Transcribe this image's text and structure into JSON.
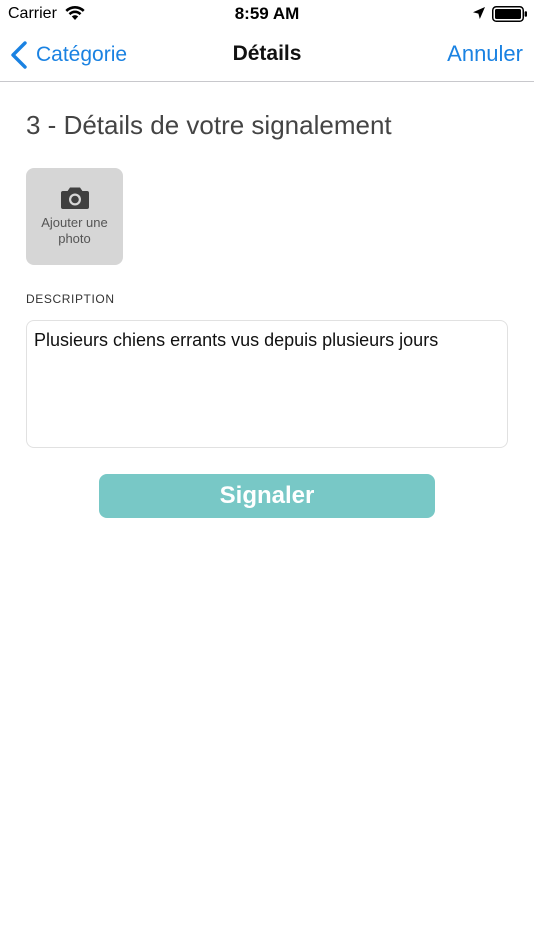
{
  "status_bar": {
    "carrier": "Carrier",
    "time": "8:59 AM",
    "icons": [
      "wifi-icon",
      "location-icon",
      "battery-icon"
    ]
  },
  "nav": {
    "back_label": "Catégorie",
    "title": "Détails",
    "cancel_label": "Annuler"
  },
  "form": {
    "section_title": "3 - Détails de votre signalement",
    "photo_button_label": "Ajouter une photo",
    "description_label": "DESCRIPTION",
    "description_value": "Plusieurs chiens errants vus depuis plusieurs jours",
    "submit_label": "Signaler"
  },
  "colors": {
    "accent": "#1a82e2",
    "submit_button": "#78c8c6",
    "photo_button": "#d6d6d6"
  }
}
